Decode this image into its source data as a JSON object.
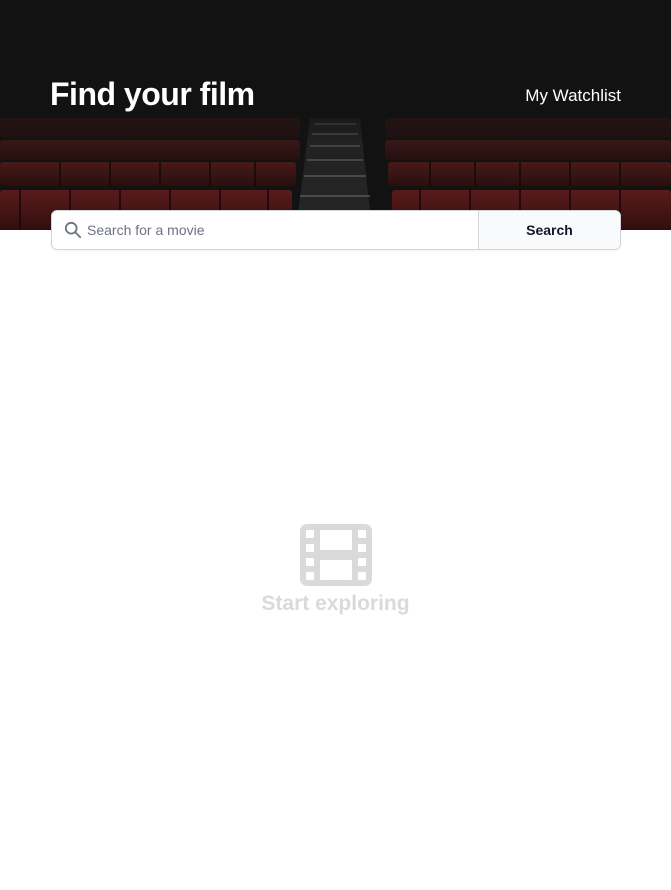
{
  "header": {
    "title": "Find your film",
    "watchlist_link": "My Watchlist"
  },
  "search": {
    "placeholder": "Search for a movie",
    "button_label": "Search"
  },
  "empty_state": {
    "message": "Start exploring",
    "icon": "film-icon"
  },
  "colors": {
    "hero_background": "#121212",
    "seat_red": "#6e1a1a",
    "empty_state_gray": "#dadada"
  }
}
